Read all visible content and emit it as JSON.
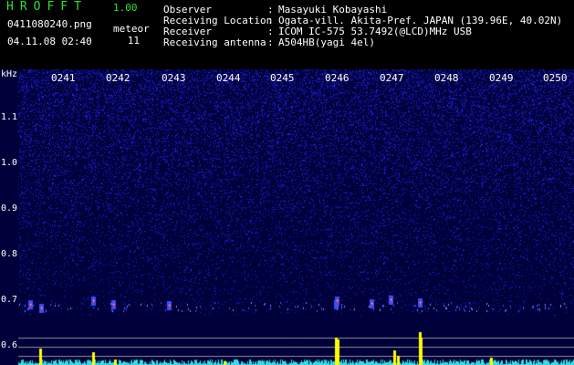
{
  "header": {
    "app_title": "HROFFT",
    "app_version": "1.00",
    "file_name": "0411080240.png",
    "date_time": "04.11.08 02:40",
    "meteor_label": "meteor",
    "meteor_count": "11",
    "info": [
      {
        "key": "Observer",
        "value": "Masayuki Kobayashi"
      },
      {
        "key": "Receiving Location",
        "value": "Ogata-vill. Akita-Pref. JAPAN (139.96E, 40.02N)"
      },
      {
        "key": "Receiver",
        "value": "ICOM IC-575 53.7492(@LCD)MHz USB"
      },
      {
        "key": "Receiving antenna",
        "value": "A504HB(yagi 4el)"
      }
    ]
  },
  "spectrogram": {
    "unit": "kHz",
    "time_labels": [
      "0241",
      "0242",
      "0243",
      "0244",
      "0245",
      "0246",
      "0247",
      "0248",
      "0249",
      "0250"
    ],
    "freq_labels": [
      "1.1",
      "1.0",
      "0.9",
      "0.8",
      "0.7",
      "0.6"
    ],
    "colors": {
      "background": "#00003a",
      "noise": "#2a2aff",
      "signal": "#ff3030",
      "meter": "#ffff00",
      "meter_base": "#30e0e0"
    }
  }
}
